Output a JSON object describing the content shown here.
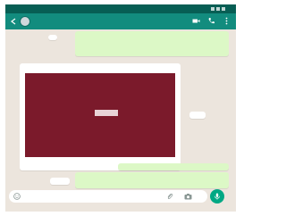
{
  "status_bar": {
    "time": ""
  },
  "contact": {
    "name": "",
    "status": ""
  },
  "messages": [
    {
      "id": "b2",
      "direction": "out",
      "lines": [
        "",
        ""
      ],
      "time": ""
    },
    {
      "id": "card",
      "direction": "in",
      "header": "",
      "card_lines": [
        "",
        "",
        ""
      ],
      "button_label": "",
      "caption": "",
      "time": ""
    },
    {
      "id": "b5",
      "direction": "out",
      "lines": [
        ""
      ]
    },
    {
      "id": "b7",
      "direction": "out",
      "lines": [
        "",
        ""
      ]
    }
  ],
  "input": {
    "placeholder": ""
  },
  "colors": {
    "status_bar": "#075e54",
    "app_bar": "#128c7e",
    "chat_bg": "#ece5dd",
    "outgoing_bubble": "#dcf8c6",
    "card_bg": "#7b1a2b",
    "send_button": "#00a884"
  },
  "icons": [
    "back-arrow-icon",
    "video-call-icon",
    "phone-call-icon",
    "more-vert-icon",
    "emoji-icon",
    "attach-icon",
    "camera-icon",
    "mic-icon"
  ]
}
